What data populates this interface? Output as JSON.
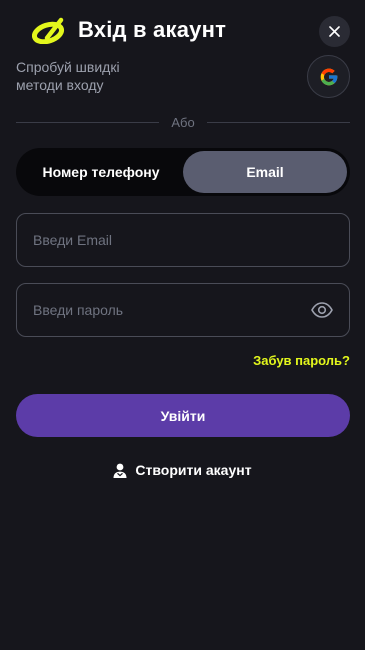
{
  "header": {
    "title": "Вхід в акаунт",
    "logo_icon": "brand-logo-icon",
    "brand_color": "#e3f71c"
  },
  "close": {
    "icon": "close-icon"
  },
  "quick_login": {
    "line1": "Спробуй швидкі",
    "line2": "методи входу",
    "google_icon": "google-icon"
  },
  "divider": {
    "label": "Або"
  },
  "tabs": [
    {
      "label": "Номер телефону",
      "active": false
    },
    {
      "label": "Email",
      "active": true
    }
  ],
  "email": {
    "placeholder": "Введи Email",
    "value": ""
  },
  "password": {
    "placeholder": "Введи пароль",
    "value": "",
    "toggle_icon": "eye-icon"
  },
  "forgot": {
    "label": "Забув пароль?"
  },
  "login_button": {
    "label": "Увійти",
    "color": "#5c3ca8"
  },
  "create_account": {
    "label": "Створити акаунт",
    "icon": "user-icon"
  }
}
